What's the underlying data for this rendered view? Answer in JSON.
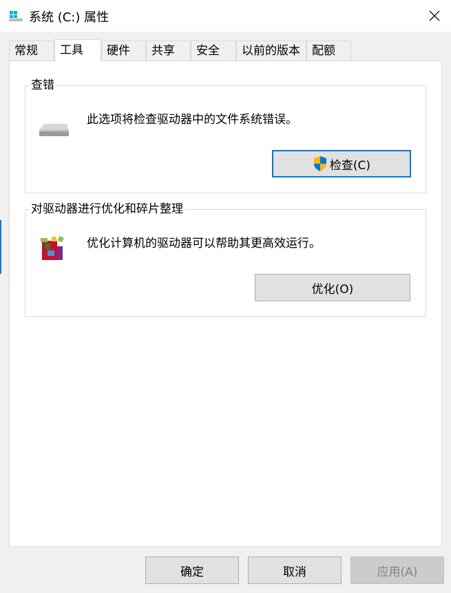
{
  "window": {
    "title": "系统 (C:) 属性",
    "icon": "drive-icon"
  },
  "tabs": [
    {
      "label": "常规",
      "active": false
    },
    {
      "label": "工具",
      "active": true
    },
    {
      "label": "硬件",
      "active": false
    },
    {
      "label": "共享",
      "active": false
    },
    {
      "label": "安全",
      "active": false
    },
    {
      "label": "以前的版本",
      "active": false
    },
    {
      "label": "配额",
      "active": false
    }
  ],
  "error_checking": {
    "title": "查错",
    "description": "此选项将检查驱动器中的文件系统错误。",
    "button_label": "检查(C)",
    "icon": "hard-drive-icon"
  },
  "optimize": {
    "title": "对驱动器进行优化和碎片整理",
    "description": "优化计算机的驱动器可以帮助其更高效运行。",
    "button_label": "优化(O)",
    "icon": "defrag-icon"
  },
  "footer": {
    "ok_label": "确定",
    "cancel_label": "取消",
    "apply_label": "应用(A)"
  },
  "colors": {
    "accent": "#0078d7",
    "button_bg": "#e1e1e1",
    "window_bg": "#f0f0f0"
  }
}
